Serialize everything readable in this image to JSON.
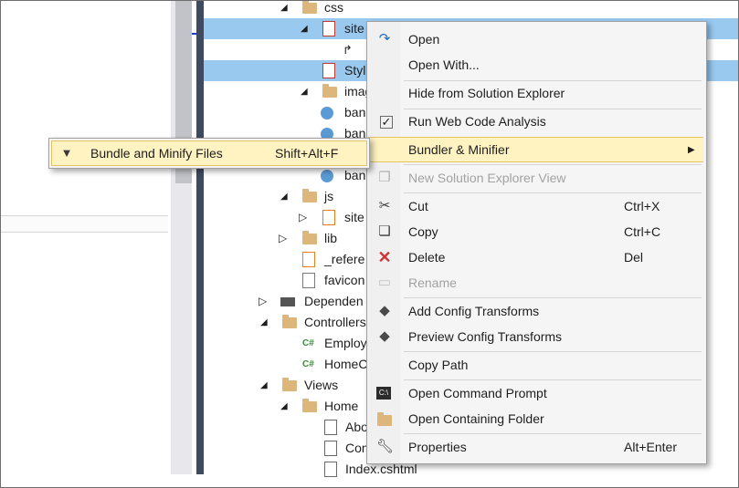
{
  "tree": {
    "rows": [
      {
        "label": "css"
      },
      {
        "label": "site"
      },
      {
        "label": ""
      },
      {
        "label": "Styl"
      },
      {
        "label": "images"
      },
      {
        "label": "ban"
      },
      {
        "label": "ban"
      },
      {
        "label": "ban"
      },
      {
        "label": "ban"
      },
      {
        "label": "js"
      },
      {
        "label": "site"
      },
      {
        "label": "lib"
      },
      {
        "label": "_refere"
      },
      {
        "label": "favicon"
      },
      {
        "label": "Dependen"
      },
      {
        "label": "Controllers"
      },
      {
        "label": "Employ"
      },
      {
        "label": "HomeC"
      },
      {
        "label": "Views"
      },
      {
        "label": "Home"
      },
      {
        "label": "Abo"
      },
      {
        "label": "Con"
      },
      {
        "label": "Index.cshtml"
      }
    ],
    "cs_glyph": "C#"
  },
  "context_menu": {
    "open": "Open",
    "open_with": "Open With...",
    "hide": "Hide from Solution Explorer",
    "code_analysis": "Run Web Code Analysis",
    "bundler": "Bundler & Minifier",
    "new_view": "New Solution Explorer View",
    "cut": "Cut",
    "cut_sc": "Ctrl+X",
    "copy": "Copy",
    "copy_sc": "Ctrl+C",
    "delete": "Delete",
    "delete_sc": "Del",
    "rename": "Rename",
    "add_transforms": "Add Config Transforms",
    "preview_transforms": "Preview Config Transforms",
    "copy_path": "Copy Path",
    "cmd_prompt": "Open Command Prompt",
    "containing_folder": "Open Containing Folder",
    "properties": "Properties",
    "properties_sc": "Alt+Enter"
  },
  "submenu": {
    "bundle": "Bundle and Minify Files",
    "bundle_sc": "Shift+Alt+F"
  },
  "colors": {
    "highlight": "#fff3c2",
    "selection": "#3399ff",
    "delete_icon": "#d13438"
  }
}
